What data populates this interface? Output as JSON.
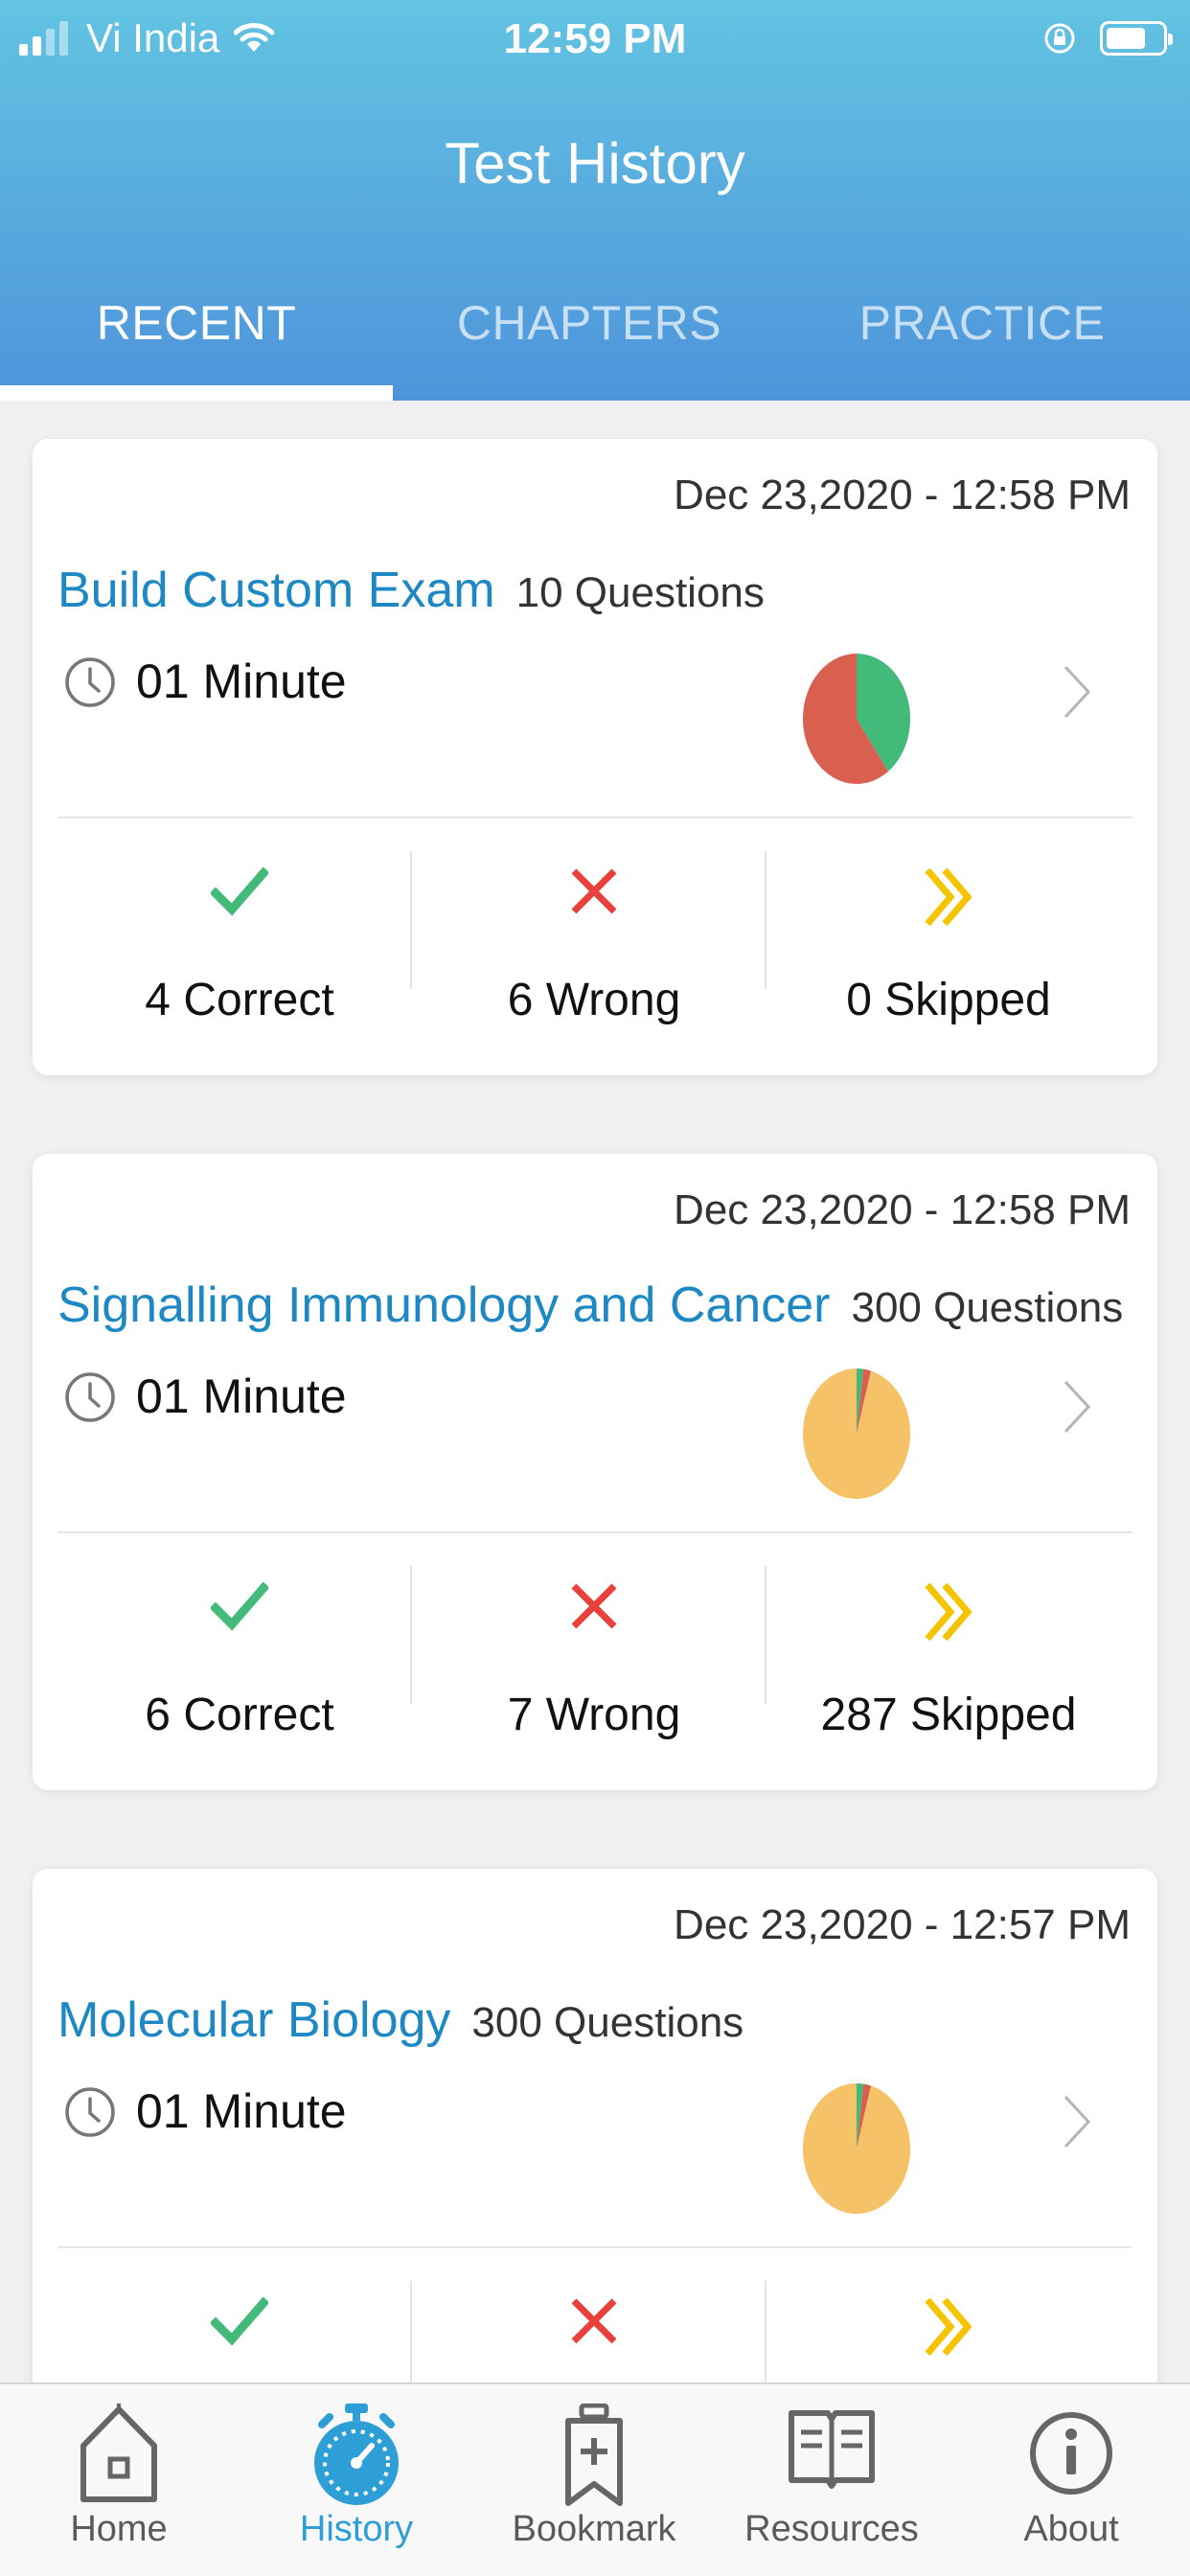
{
  "status_bar": {
    "carrier": "Vi India",
    "time": "12:59 PM"
  },
  "header": {
    "title": "Test History"
  },
  "tabs": [
    {
      "label": "RECENT",
      "active": true
    },
    {
      "label": "CHAPTERS",
      "active": false
    },
    {
      "label": "PRACTICE",
      "active": false
    }
  ],
  "history": [
    {
      "date": "Dec 23,2020 - 12:58 PM",
      "title": "Build Custom Exam",
      "questions": "10 Questions",
      "duration": "01 Minute",
      "correct_label": "4 Correct",
      "wrong_label": "6 Wrong",
      "skipped_label": "0 Skipped",
      "correct": 4,
      "wrong": 6,
      "skipped": 0
    },
    {
      "date": "Dec 23,2020 - 12:58 PM",
      "title": "Signalling Immunology and Cancer",
      "questions": "300 Questions",
      "duration": "01 Minute",
      "correct_label": "6 Correct",
      "wrong_label": "7 Wrong",
      "skipped_label": "287 Skipped",
      "correct": 6,
      "wrong": 7,
      "skipped": 287
    },
    {
      "date": "Dec 23,2020 - 12:57 PM",
      "title": "Molecular Biology",
      "questions": "300 Questions",
      "duration": "01 Minute",
      "correct_label": "",
      "wrong_label": "",
      "skipped_label": "",
      "correct": 6,
      "wrong": 7,
      "skipped": 287
    }
  ],
  "colors": {
    "correct": "#43b97a",
    "wrong": "#d9604f",
    "skipped": "#f6c267",
    "accent": "#2e9fd6"
  },
  "bottom_nav": [
    {
      "label": "Home",
      "icon": "home-icon",
      "active": false
    },
    {
      "label": "History",
      "icon": "stopwatch-icon",
      "active": true
    },
    {
      "label": "Bookmark",
      "icon": "bookmark-icon",
      "active": false
    },
    {
      "label": "Resources",
      "icon": "book-icon",
      "active": false
    },
    {
      "label": "About",
      "icon": "info-icon",
      "active": false
    }
  ]
}
